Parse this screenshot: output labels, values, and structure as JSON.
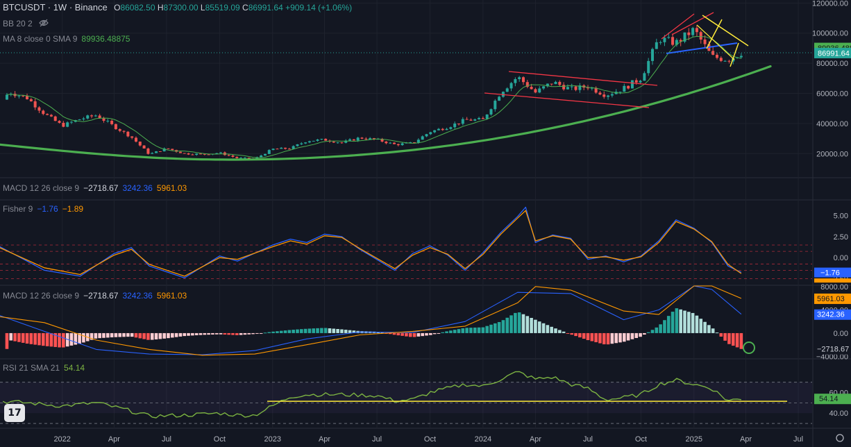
{
  "header": {
    "symbol": "BTCUSDT · 1W · Binance",
    "o_label": "O",
    "o_value": "86082.50",
    "h_label": "H",
    "h_value": "87300.00",
    "l_label": "L",
    "l_value": "85519.09",
    "c_label": "C",
    "c_value": "86991.64",
    "change": "+909.14 (+1.06%)",
    "bb_label": "BB 20 2",
    "ma_label": "MA 8 close 0 SMA 9",
    "ma_value": "89936.48875",
    "eye_icon": "eye-off-icon"
  },
  "pane_legends": {
    "macd1": {
      "label": "MACD 12 26 close 9",
      "v1": "−2718.67",
      "v2": "3242.36",
      "v3": "5961.03"
    },
    "fisher": {
      "label": "Fisher 9",
      "v1": "−1.76",
      "v2": "−1.89"
    },
    "macd2": {
      "label": "MACD 12 26 close 9",
      "v1": "−2718.67",
      "v2": "3242.36",
      "v3": "5961.03"
    },
    "rsi": {
      "label": "RSI 21 SMA 21",
      "v1": "54.14"
    }
  },
  "colors": {
    "background": "#131722",
    "up": "#26a69a",
    "down": "#ef5350",
    "ma": "#4caf50",
    "curve": "#4caf50",
    "macd": "#2962ff",
    "signal": "#ff9800",
    "rsi": "#7cb342",
    "channel": "#f23645",
    "trend_yellow": "#ffeb3b",
    "trend_blue": "#2962ff"
  },
  "chart_data": [
    {
      "type": "candlestick",
      "pane": "price",
      "yticks": [
        20000,
        40000,
        60000,
        80000,
        100000,
        120000
      ],
      "ytick_labels": [
        "20000.00",
        "40000.00",
        "60000.00",
        "80000.00",
        "100000.00",
        "120000.00"
      ],
      "ylim": [
        4000,
        122000
      ],
      "x_labels": [
        "2022",
        "Apr",
        "Jul",
        "Oct",
        "2023",
        "Apr",
        "Jul",
        "Oct",
        "2024",
        "Apr",
        "Jul",
        "Oct",
        "2025",
        "Apr",
        "Jul"
      ],
      "x_positions": [
        "2022-01",
        "2022-04",
        "2022-07",
        "2022-10",
        "2023-01",
        "2023-04",
        "2023-07",
        "2023-10",
        "2024-01",
        "2024-04",
        "2024-07",
        "2024-10",
        "2025-01",
        "2025-04",
        "2025-07"
      ],
      "close_series": [
        [
          "2021-09",
          47000
        ],
        [
          "2021-10",
          61000
        ],
        [
          "2021-11",
          57000
        ],
        [
          "2021-12",
          46500
        ],
        [
          "2022-01",
          38500
        ],
        [
          "2022-02",
          43000
        ],
        [
          "2022-03",
          45500
        ],
        [
          "2022-04",
          38000
        ],
        [
          "2022-05",
          31000
        ],
        [
          "2022-06",
          19500
        ],
        [
          "2022-07",
          23500
        ],
        [
          "2022-08",
          20000
        ],
        [
          "2022-09",
          19500
        ],
        [
          "2022-10",
          20500
        ],
        [
          "2022-11",
          17000
        ],
        [
          "2022-12",
          16500
        ],
        [
          "2023-01",
          23000
        ],
        [
          "2023-02",
          23500
        ],
        [
          "2023-03",
          28500
        ],
        [
          "2023-04",
          29200
        ],
        [
          "2023-05",
          27200
        ],
        [
          "2023-06",
          30500
        ],
        [
          "2023-07",
          29200
        ],
        [
          "2023-08",
          26000
        ],
        [
          "2023-09",
          27000
        ],
        [
          "2023-10",
          34500
        ],
        [
          "2023-11",
          37700
        ],
        [
          "2023-12",
          42300
        ],
        [
          "2024-01",
          42500
        ],
        [
          "2024-02",
          61000
        ],
        [
          "2024-03",
          71000
        ],
        [
          "2024-04",
          60600
        ],
        [
          "2024-05",
          67500
        ],
        [
          "2024-06",
          62700
        ],
        [
          "2024-07",
          64600
        ],
        [
          "2024-08",
          58900
        ],
        [
          "2024-09",
          63300
        ],
        [
          "2024-10",
          70200
        ],
        [
          "2024-11",
          96400
        ],
        [
          "2024-12",
          93500
        ],
        [
          "2025-01",
          102400
        ],
        [
          "2025-02",
          84300
        ],
        [
          "2025-03",
          82500
        ],
        [
          "2025-03-24",
          86991.64
        ]
      ],
      "last_price": 86991.64,
      "last_price_label": "86991.64",
      "ma_value": 89936.48875,
      "ma_value_label": "89936.488"
    },
    {
      "type": "line",
      "pane": "fisher",
      "yticks": [
        -2.5,
        0,
        2.5,
        5
      ],
      "ytick_labels": [
        "−2.50",
        "0.00",
        "2.50",
        "5.00"
      ],
      "levels": [
        -2.5,
        -1.5,
        -0.75,
        0.75,
        1.5
      ],
      "series": [
        {
          "values": [
            [
              "2021-09",
              1.8
            ],
            [
              "2021-12",
              -1.5
            ],
            [
              "2022-02",
              -2.2
            ],
            [
              "2022-04",
              0.5
            ],
            [
              "2022-05",
              1.2
            ],
            [
              "2022-06",
              -1.0
            ],
            [
              "2022-08",
              -2.4
            ],
            [
              "2022-10",
              0.2
            ],
            [
              "2022-11",
              -0.4
            ],
            [
              "2023-01",
              1.5
            ],
            [
              "2023-02",
              2.2
            ],
            [
              "2023-03",
              1.8
            ],
            [
              "2023-04",
              2.8
            ],
            [
              "2023-05",
              2.5
            ],
            [
              "2023-06",
              1.0
            ],
            [
              "2023-08",
              -1.5
            ],
            [
              "2023-09",
              0.5
            ],
            [
              "2023-10",
              1.4
            ],
            [
              "2023-11",
              0.3
            ],
            [
              "2023-12",
              -1.5
            ],
            [
              "2024-01",
              0.6
            ],
            [
              "2024-02",
              3.0
            ],
            [
              "2024-03",
              4.9
            ],
            [
              "2024-03-15",
              6.0
            ],
            [
              "2024-04",
              1.8
            ],
            [
              "2024-05",
              2.7
            ],
            [
              "2024-06",
              2.3
            ],
            [
              "2024-07",
              -0.2
            ],
            [
              "2024-08",
              0.2
            ],
            [
              "2024-09",
              -0.5
            ],
            [
              "2024-10",
              0.2
            ],
            [
              "2024-11",
              2.0
            ],
            [
              "2024-12",
              4.5
            ],
            [
              "2025-01",
              3.5
            ],
            [
              "2025-02",
              1.8
            ],
            [
              "2025-03",
              -1.0
            ],
            [
              "2025-03-24",
              -1.76
            ]
          ]
        },
        {
          "values": [
            [
              "2021-09",
              1.6
            ],
            [
              "2021-12",
              -1.2
            ],
            [
              "2022-02",
              -2.0
            ],
            [
              "2022-04",
              0.3
            ],
            [
              "2022-05",
              1.0
            ],
            [
              "2022-06",
              -0.8
            ],
            [
              "2022-08",
              -2.2
            ],
            [
              "2022-10",
              0.0
            ],
            [
              "2022-11",
              -0.2
            ],
            [
              "2023-01",
              1.3
            ],
            [
              "2023-02",
              2.0
            ],
            [
              "2023-03",
              1.6
            ],
            [
              "2023-04",
              2.6
            ],
            [
              "2023-05",
              2.4
            ],
            [
              "2023-06",
              1.1
            ],
            [
              "2023-08",
              -1.3
            ],
            [
              "2023-09",
              0.3
            ],
            [
              "2023-10",
              1.2
            ],
            [
              "2023-11",
              0.4
            ],
            [
              "2023-12",
              -1.3
            ],
            [
              "2024-01",
              0.4
            ],
            [
              "2024-02",
              2.8
            ],
            [
              "2024-03",
              4.7
            ],
            [
              "2024-03-15",
              5.6
            ],
            [
              "2024-04",
              2.0
            ],
            [
              "2024-05",
              2.6
            ],
            [
              "2024-06",
              2.2
            ],
            [
              "2024-07",
              0.0
            ],
            [
              "2024-08",
              0.1
            ],
            [
              "2024-09",
              -0.3
            ],
            [
              "2024-10",
              0.1
            ],
            [
              "2024-11",
              1.8
            ],
            [
              "2024-12",
              4.3
            ],
            [
              "2025-01",
              3.4
            ],
            [
              "2025-02",
              1.9
            ],
            [
              "2025-03",
              -0.8
            ],
            [
              "2025-03-24",
              -1.89
            ]
          ]
        }
      ]
    },
    {
      "type": "bar+line",
      "pane": "macd",
      "yticks": [
        -4000,
        0,
        4000,
        8000
      ],
      "ytick_labels": [
        "−4000.00",
        "0.00",
        "4000.00",
        "8000.00"
      ],
      "histogram": [
        [
          "2021-10",
          -1200
        ],
        [
          "2021-11",
          -1800
        ],
        [
          "2021-12",
          -2200
        ],
        [
          "2022-01",
          -2500
        ],
        [
          "2022-02",
          -1800
        ],
        [
          "2022-03",
          -900
        ],
        [
          "2022-04",
          -700
        ],
        [
          "2022-05",
          -600
        ],
        [
          "2022-06",
          -1200
        ],
        [
          "2022-07",
          -900
        ],
        [
          "2022-08",
          -500
        ],
        [
          "2022-09",
          -300
        ],
        [
          "2022-10",
          -200
        ],
        [
          "2022-11",
          -350
        ],
        [
          "2022-12",
          -150
        ],
        [
          "2023-01",
          250
        ],
        [
          "2023-02",
          550
        ],
        [
          "2023-03",
          750
        ],
        [
          "2023-04",
          900
        ],
        [
          "2023-05",
          650
        ],
        [
          "2023-06",
          350
        ],
        [
          "2023-07",
          250
        ],
        [
          "2023-08",
          -300
        ],
        [
          "2023-09",
          -700
        ],
        [
          "2023-10",
          -350
        ],
        [
          "2023-11",
          350
        ],
        [
          "2023-12",
          900
        ],
        [
          "2024-01",
          1000
        ],
        [
          "2024-02",
          2000
        ],
        [
          "2024-03",
          3700
        ],
        [
          "2024-04",
          2300
        ],
        [
          "2024-05",
          1000
        ],
        [
          "2024-06",
          -200
        ],
        [
          "2024-07",
          -1200
        ],
        [
          "2024-08",
          -2000
        ],
        [
          "2024-09",
          -1500
        ],
        [
          "2024-10",
          -600
        ],
        [
          "2024-11",
          1200
        ],
        [
          "2024-12",
          4300
        ],
        [
          "2025-01",
          3400
        ],
        [
          "2025-02",
          1000
        ],
        [
          "2025-03",
          -1800
        ],
        [
          "2025-03-24",
          -2718.67
        ]
      ],
      "series": [
        {
          "values": [
            [
              "2021-09",
              3500
            ],
            [
              "2021-12",
              300
            ],
            [
              "2022-03",
              -2800
            ],
            [
              "2022-06",
              -3600
            ],
            [
              "2022-09",
              -3700
            ],
            [
              "2022-12",
              -3000
            ],
            [
              "2023-03",
              -1000
            ],
            [
              "2023-06",
              200
            ],
            [
              "2023-09",
              100
            ],
            [
              "2023-12",
              2000
            ],
            [
              "2024-03",
              7000
            ],
            [
              "2024-06",
              6800
            ],
            [
              "2024-09",
              2300
            ],
            [
              "2024-11",
              4000
            ],
            [
              "2025-01",
              9600
            ],
            [
              "2025-02",
              7500
            ],
            [
              "2025-03-24",
              3242.36
            ]
          ]
        },
        {
          "values": [
            [
              "2021-09",
              3000
            ],
            [
              "2021-12",
              1800
            ],
            [
              "2022-03",
              -1200
            ],
            [
              "2022-06",
              -2800
            ],
            [
              "2022-09",
              -3800
            ],
            [
              "2022-12",
              -3600
            ],
            [
              "2023-03",
              -2000
            ],
            [
              "2023-06",
              -300
            ],
            [
              "2023-09",
              300
            ],
            [
              "2023-12",
              1200
            ],
            [
              "2024-03",
              5200
            ],
            [
              "2024-04",
              8000
            ],
            [
              "2024-06",
              7400
            ],
            [
              "2024-09",
              3800
            ],
            [
              "2024-11",
              3200
            ],
            [
              "2025-01",
              8600
            ],
            [
              "2025-02",
              8700
            ],
            [
              "2025-03-24",
              5961.03
            ]
          ]
        }
      ]
    },
    {
      "type": "line",
      "pane": "rsi",
      "yticks": [
        40,
        60
      ],
      "ytick_labels": [
        "40.00",
        "60.00"
      ],
      "band": [
        40,
        70
      ],
      "series": [
        {
          "values": [
            [
              "2021-09",
              52
            ],
            [
              "2021-11",
              50
            ],
            [
              "2022-01",
              47
            ],
            [
              "2022-03",
              50
            ],
            [
              "2022-04",
              46
            ],
            [
              "2022-05",
              42
            ],
            [
              "2022-06",
              37
            ],
            [
              "2022-08",
              38
            ],
            [
              "2022-09",
              39
            ],
            [
              "2022-10",
              40
            ],
            [
              "2022-11",
              38
            ],
            [
              "2022-12",
              38
            ],
            [
              "2023-01",
              47
            ],
            [
              "2023-02",
              56
            ],
            [
              "2023-03",
              58
            ],
            [
              "2023-05",
              58
            ],
            [
              "2023-07",
              57
            ],
            [
              "2023-08",
              52
            ],
            [
              "2023-09",
              53
            ],
            [
              "2023-10",
              60
            ],
            [
              "2023-12",
              68
            ],
            [
              "2024-01",
              66
            ],
            [
              "2024-02",
              73
            ],
            [
              "2024-03",
              80
            ],
            [
              "2024-04",
              73
            ],
            [
              "2024-05",
              75
            ],
            [
              "2024-06",
              68
            ],
            [
              "2024-07",
              64
            ],
            [
              "2024-08",
              53
            ],
            [
              "2024-09",
              55
            ],
            [
              "2024-10",
              58
            ],
            [
              "2024-11",
              68
            ],
            [
              "2024-12",
              72
            ],
            [
              "2025-01",
              68
            ],
            [
              "2025-02",
              64
            ],
            [
              "2025-03",
              52
            ],
            [
              "2025-03-24",
              54.14
            ]
          ]
        }
      ],
      "horizontal_line": 51.5
    }
  ],
  "x_range": [
    "2021-09-15",
    "2025-07-25"
  ]
}
